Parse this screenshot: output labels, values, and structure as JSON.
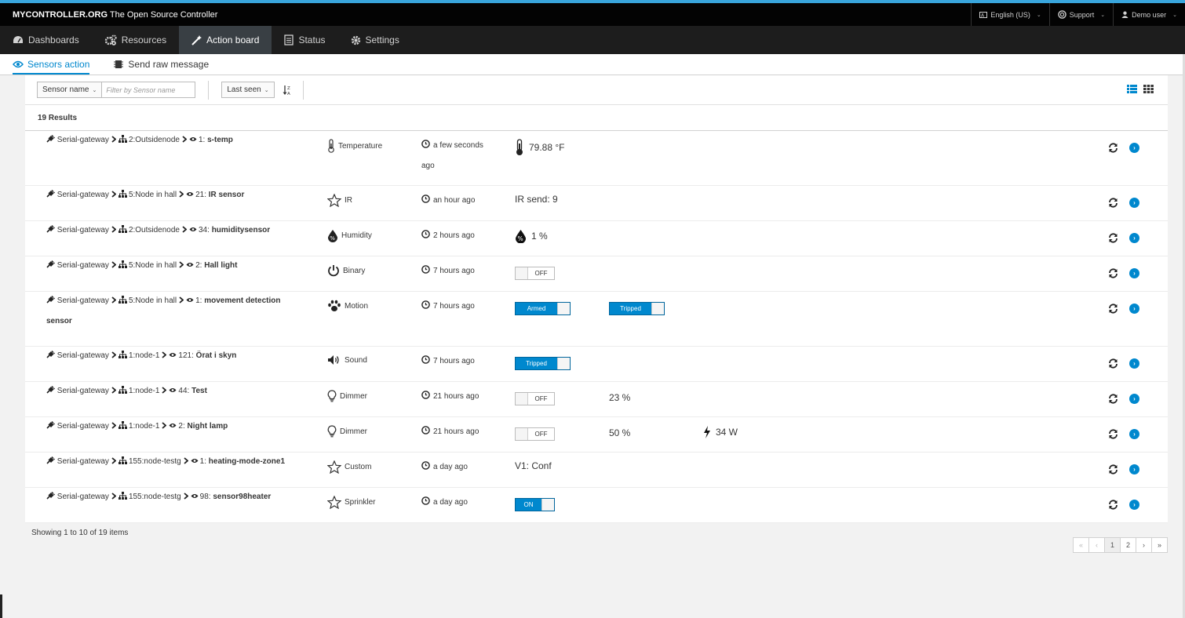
{
  "header": {
    "brand": "MYCONTROLLER.ORG",
    "tagline": "The Open Source Controller",
    "language": "English (US)",
    "support": "Support",
    "user": "Demo user"
  },
  "nav": [
    {
      "label": "Dashboards",
      "icon": "dashboard-icon"
    },
    {
      "label": "Resources",
      "icon": "cogs-icon"
    },
    {
      "label": "Action board",
      "icon": "magic-wand-icon"
    },
    {
      "label": "Status",
      "icon": "document-icon"
    },
    {
      "label": "Settings",
      "icon": "gear-icon"
    }
  ],
  "subnav": {
    "sensors_action": "Sensors action",
    "send_raw": "Send raw message"
  },
  "filter": {
    "field": "Sensor name",
    "placeholder": "Filter by Sensor name",
    "sort": "Last seen"
  },
  "results_label": "19 Results",
  "rows": [
    {
      "gateway": "Serial-gateway",
      "node": "2:Outsidenode",
      "sensor_id": "1:",
      "sensor_name": "s-temp",
      "type": "Temperature",
      "time": "a few seconds ago",
      "value": "79.88 °F"
    },
    {
      "gateway": "Serial-gateway",
      "node": "5:Node in hall",
      "sensor_id": "21:",
      "sensor_name": "IR sensor",
      "type": "IR",
      "time": "an hour ago",
      "value": "IR send: 9"
    },
    {
      "gateway": "Serial-gateway",
      "node": "2:Outsidenode",
      "sensor_id": "34:",
      "sensor_name": "humiditysensor",
      "type": "Humidity",
      "time": "2 hours ago",
      "value": "1 %"
    },
    {
      "gateway": "Serial-gateway",
      "node": "5:Node in hall",
      "sensor_id": "2:",
      "sensor_name": "Hall light",
      "type": "Binary",
      "time": "7 hours ago",
      "toggle1": "OFF"
    },
    {
      "gateway": "Serial-gateway",
      "node": "5:Node in hall",
      "sensor_id": "1:",
      "sensor_name": "movement detection sensor",
      "type": "Motion",
      "time": "7 hours ago",
      "toggle1": "Armed",
      "toggle2": "Tripped"
    },
    {
      "gateway": "Serial-gateway",
      "node": "1:node-1",
      "sensor_id": "121:",
      "sensor_name": "Örat i skyn",
      "type": "Sound",
      "time": "7 hours ago",
      "toggle1": "Tripped"
    },
    {
      "gateway": "Serial-gateway",
      "node": "1:node-1",
      "sensor_id": "44:",
      "sensor_name": "Test",
      "type": "Dimmer",
      "time": "21 hours ago",
      "toggle1": "OFF",
      "value2": "23 %"
    },
    {
      "gateway": "Serial-gateway",
      "node": "1:node-1",
      "sensor_id": "2:",
      "sensor_name": "Night lamp",
      "type": "Dimmer",
      "time": "21 hours ago",
      "toggle1": "OFF",
      "value2": "50 %",
      "value3": "34 W"
    },
    {
      "gateway": "Serial-gateway",
      "node": "155:node-testg",
      "sensor_id": "1:",
      "sensor_name": "heating-mode-zone1",
      "type": "Custom",
      "time": "a day ago",
      "value": "V1: Conf"
    },
    {
      "gateway": "Serial-gateway",
      "node": "155:node-testg",
      "sensor_id": "98:",
      "sensor_name": "sensor98heater",
      "type": "Sprinkler",
      "time": "a day ago",
      "toggle1": "ON"
    }
  ],
  "showing": "Showing 1 to 10 of 19 items",
  "pager": {
    "first": "«",
    "prev": "‹",
    "p1": "1",
    "p2": "2",
    "next": "›",
    "last": "»"
  }
}
